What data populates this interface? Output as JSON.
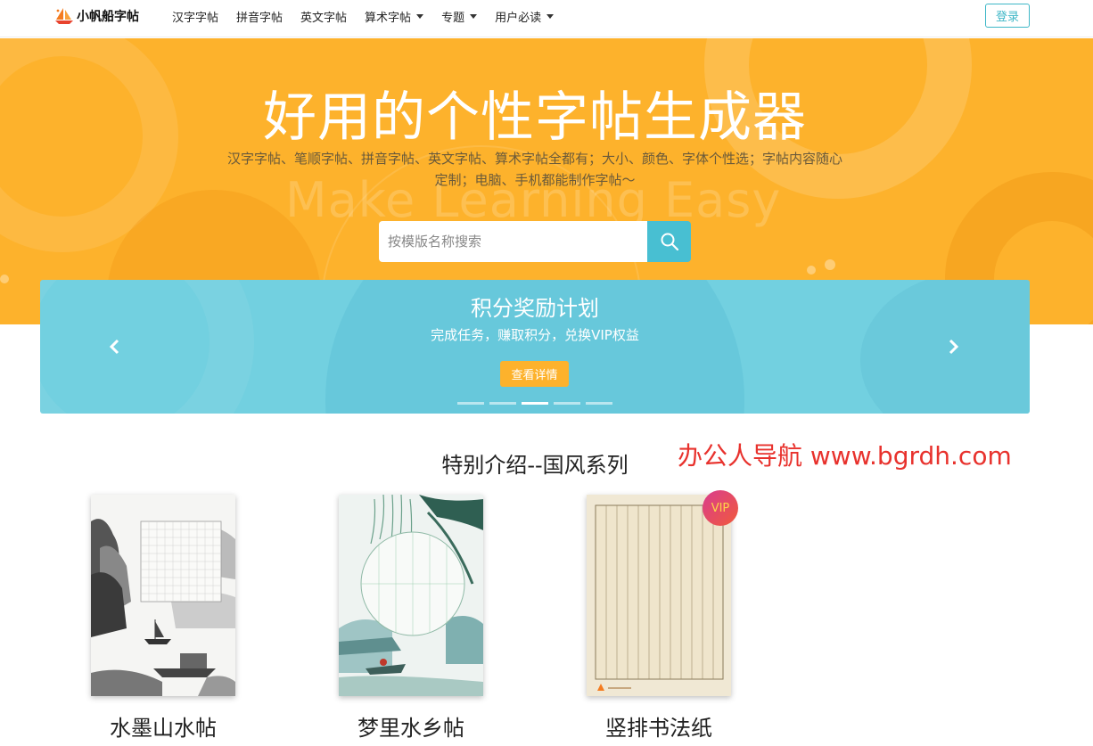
{
  "navbar": {
    "brand_name": "小帆船字帖",
    "items": [
      {
        "label": "汉字字帖",
        "dropdown": false
      },
      {
        "label": "拼音字帖",
        "dropdown": false
      },
      {
        "label": "英文字帖",
        "dropdown": false
      },
      {
        "label": "算术字帖",
        "dropdown": true
      },
      {
        "label": "专题",
        "dropdown": true
      },
      {
        "label": "用户必读",
        "dropdown": true
      }
    ],
    "login_label": "登录"
  },
  "hero": {
    "title": "好用的个性字帖生成器",
    "subtitle": "汉字字帖、笔顺字帖、拼音字帖、英文字帖、算术字帖全都有；大小、颜色、字体个性选；字帖内容随心定制；电脑、手机都能制作字帖～",
    "watermark": "Make Learning Easy",
    "search_placeholder": "按模版名称搜索",
    "colors": {
      "background": "#fdb22c",
      "search_button": "#48bfd2"
    }
  },
  "carousel": {
    "title": "积分奖励计划",
    "subtitle": "完成任务，赚取积分，兑换VIP权益",
    "button_label": "查看详情",
    "active_slide": 3,
    "slide_count": 5,
    "colors": {
      "background": "#72d0e0",
      "button": "#fdb22c"
    }
  },
  "section": {
    "title": "特别介绍--国风系列",
    "watermark": "办公人导航 www.bgrdh.com",
    "cards": [
      {
        "label": "水墨山水帖",
        "vip": false
      },
      {
        "label": "梦里水乡帖",
        "vip": false
      },
      {
        "label": "竖排书法纸",
        "vip": true
      }
    ],
    "vip_badge": "VIP"
  }
}
